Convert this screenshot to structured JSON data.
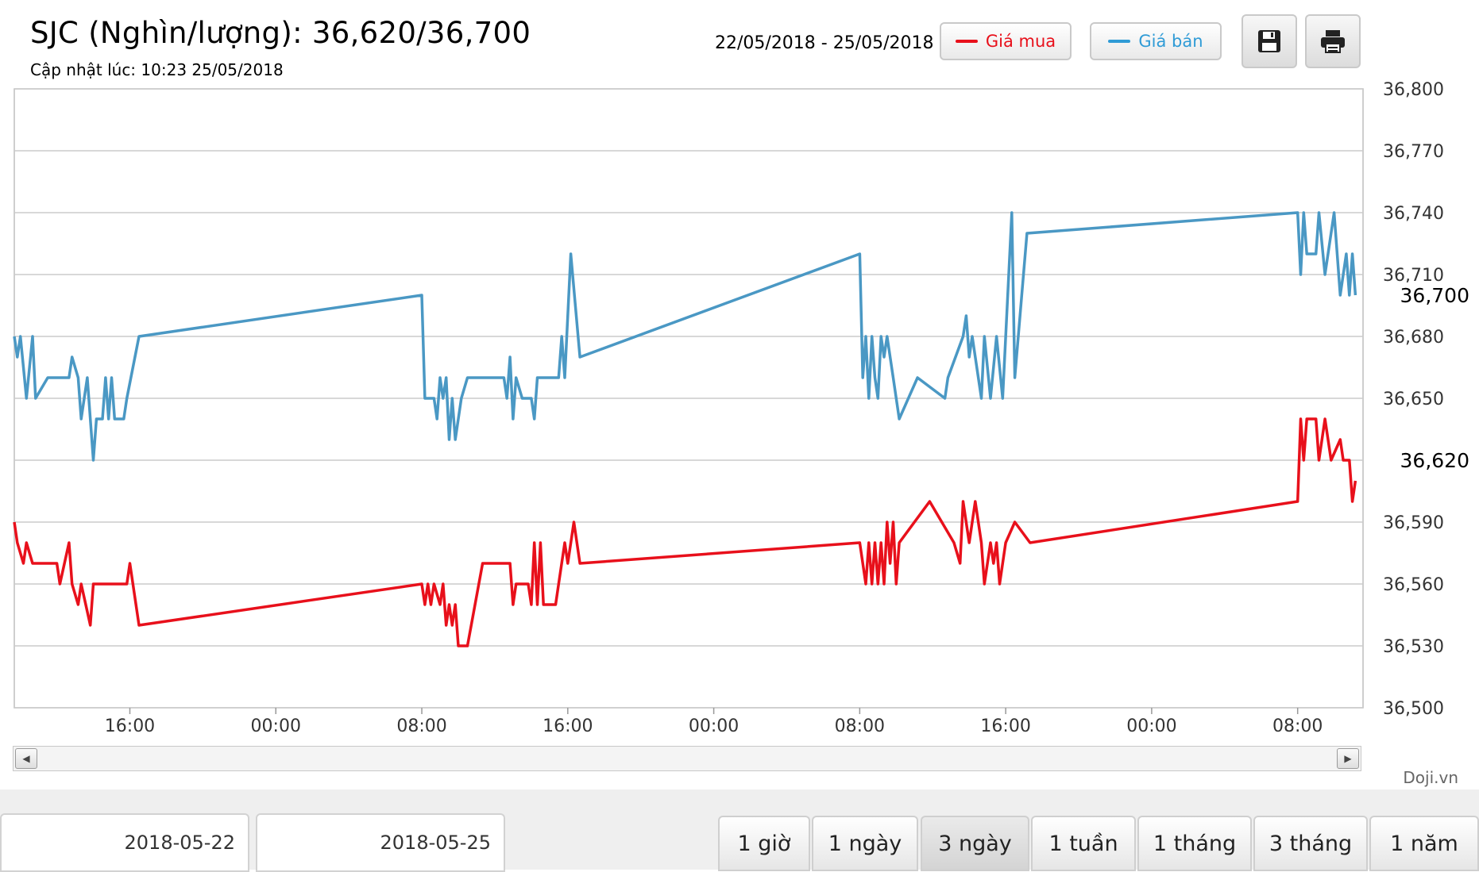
{
  "header": {
    "title": "SJC (Nghìn/lượng): 36,620/36,700",
    "updated": "Cập nhật lúc: 10:23 25/05/2018",
    "date_range": "22/05/2018 - 25/05/2018"
  },
  "legend": {
    "buy_label": "Giá mua",
    "sell_label": "Giá bán"
  },
  "toolbar": {
    "save_icon": "floppy-disk-icon",
    "print_icon": "printer-icon"
  },
  "credit": "Doji.vn",
  "date_inputs": {
    "from": "2018-05-22",
    "to": "2018-05-25"
  },
  "ranges": [
    {
      "label": "1 giờ",
      "active": false
    },
    {
      "label": "1 ngày",
      "active": false
    },
    {
      "label": "3 ngày",
      "active": true
    },
    {
      "label": "1 tuần",
      "active": false
    },
    {
      "label": "1 tháng",
      "active": false
    },
    {
      "label": "3 tháng",
      "active": false
    },
    {
      "label": "1 năm",
      "active": false
    }
  ],
  "colors": {
    "buy": "#e8101b",
    "sell": "#4a98c4",
    "grid": "#cccccc"
  },
  "chart_data": {
    "type": "line",
    "title": "",
    "ylim": [
      36500,
      36800
    ],
    "y_ticks": [
      36500,
      36530,
      36560,
      36590,
      36620,
      36650,
      36680,
      36710,
      36740,
      36770,
      36800
    ],
    "y_tick_labels": [
      "36,500",
      "36,530",
      "36,560",
      "36,590",
      "36,620",
      "36,650",
      "36,680",
      "36,710",
      "36,740",
      "36,770",
      "36,800"
    ],
    "xlim": [
      "2018-05-22 09:40",
      "2018-05-25 11:35"
    ],
    "x_ticks": [
      "2018-05-22 16:00",
      "2018-05-23 00:00",
      "2018-05-23 08:00",
      "2018-05-23 16:00",
      "2018-05-24 00:00",
      "2018-05-24 08:00",
      "2018-05-24 16:00",
      "2018-05-25 00:00",
      "2018-05-25 08:00"
    ],
    "x_tick_labels": [
      "16:00",
      "00:00",
      "08:00",
      "16:00",
      "00:00",
      "08:00",
      "16:00",
      "00:00",
      "08:00"
    ],
    "current_labels": [
      {
        "series": "Giá bán",
        "value": 36700,
        "text": "36,700"
      },
      {
        "series": "Giá mua",
        "value": 36620,
        "text": "36,620"
      }
    ],
    "series": [
      {
        "name": "Giá bán",
        "color": "#4a98c4",
        "points": [
          [
            "2018-05-22 09:40",
            36680
          ],
          [
            "2018-05-22 09:50",
            36670
          ],
          [
            "2018-05-22 10:00",
            36680
          ],
          [
            "2018-05-22 10:20",
            36650
          ],
          [
            "2018-05-22 10:40",
            36680
          ],
          [
            "2018-05-22 10:50",
            36650
          ],
          [
            "2018-05-22 11:30",
            36660
          ],
          [
            "2018-05-22 12:00",
            36660
          ],
          [
            "2018-05-22 12:20",
            36660
          ],
          [
            "2018-05-22 12:40",
            36660
          ],
          [
            "2018-05-22 12:50",
            36670
          ],
          [
            "2018-05-22 13:10",
            36660
          ],
          [
            "2018-05-22 13:20",
            36640
          ],
          [
            "2018-05-22 13:40",
            36660
          ],
          [
            "2018-05-22 13:50",
            36640
          ],
          [
            "2018-05-22 14:00",
            36620
          ],
          [
            "2018-05-22 14:10",
            36640
          ],
          [
            "2018-05-22 14:30",
            36640
          ],
          [
            "2018-05-22 14:40",
            36660
          ],
          [
            "2018-05-22 14:50",
            36640
          ],
          [
            "2018-05-22 15:00",
            36660
          ],
          [
            "2018-05-22 15:10",
            36640
          ],
          [
            "2018-05-22 15:40",
            36640
          ],
          [
            "2018-05-22 15:50",
            36650
          ],
          [
            "2018-05-22 16:30",
            36680
          ],
          [
            "2018-05-23 08:00",
            36700
          ],
          [
            "2018-05-23 08:10",
            36650
          ],
          [
            "2018-05-23 08:20",
            36650
          ],
          [
            "2018-05-23 08:40",
            36650
          ],
          [
            "2018-05-23 08:50",
            36640
          ],
          [
            "2018-05-23 09:00",
            36660
          ],
          [
            "2018-05-23 09:10",
            36650
          ],
          [
            "2018-05-23 09:20",
            36660
          ],
          [
            "2018-05-23 09:30",
            36630
          ],
          [
            "2018-05-23 09:40",
            36650
          ],
          [
            "2018-05-23 09:50",
            36630
          ],
          [
            "2018-05-23 10:10",
            36650
          ],
          [
            "2018-05-23 10:30",
            36660
          ],
          [
            "2018-05-23 12:30",
            36660
          ],
          [
            "2018-05-23 12:40",
            36650
          ],
          [
            "2018-05-23 12:50",
            36670
          ],
          [
            "2018-05-23 13:00",
            36640
          ],
          [
            "2018-05-23 13:10",
            36660
          ],
          [
            "2018-05-23 13:30",
            36650
          ],
          [
            "2018-05-23 14:00",
            36650
          ],
          [
            "2018-05-23 14:10",
            36640
          ],
          [
            "2018-05-23 14:20",
            36660
          ],
          [
            "2018-05-23 15:30",
            36660
          ],
          [
            "2018-05-23 15:40",
            36680
          ],
          [
            "2018-05-23 15:50",
            36660
          ],
          [
            "2018-05-23 16:10",
            36720
          ],
          [
            "2018-05-23 16:40",
            36670
          ],
          [
            "2018-05-24 08:00",
            36720
          ],
          [
            "2018-05-24 08:10",
            36660
          ],
          [
            "2018-05-24 08:20",
            36680
          ],
          [
            "2018-05-24 08:30",
            36650
          ],
          [
            "2018-05-24 08:40",
            36680
          ],
          [
            "2018-05-24 08:50",
            36660
          ],
          [
            "2018-05-24 09:00",
            36650
          ],
          [
            "2018-05-24 09:10",
            36680
          ],
          [
            "2018-05-24 09:20",
            36670
          ],
          [
            "2018-05-24 09:30",
            36680
          ],
          [
            "2018-05-24 09:50",
            36660
          ],
          [
            "2018-05-24 10:10",
            36640
          ],
          [
            "2018-05-24 11:10",
            36660
          ],
          [
            "2018-05-24 12:40",
            36650
          ],
          [
            "2018-05-24 12:50",
            36660
          ],
          [
            "2018-05-24 13:40",
            36680
          ],
          [
            "2018-05-24 13:50",
            36690
          ],
          [
            "2018-05-24 14:00",
            36670
          ],
          [
            "2018-05-24 14:10",
            36680
          ],
          [
            "2018-05-24 14:40",
            36650
          ],
          [
            "2018-05-24 14:50",
            36680
          ],
          [
            "2018-05-24 15:10",
            36650
          ],
          [
            "2018-05-24 15:30",
            36680
          ],
          [
            "2018-05-24 15:50",
            36650
          ],
          [
            "2018-05-24 16:20",
            36740
          ],
          [
            "2018-05-24 16:30",
            36660
          ],
          [
            "2018-05-24 17:10",
            36730
          ],
          [
            "2018-05-25 08:00",
            36740
          ],
          [
            "2018-05-25 08:10",
            36710
          ],
          [
            "2018-05-25 08:20",
            36740
          ],
          [
            "2018-05-25 08:30",
            36720
          ],
          [
            "2018-05-25 09:00",
            36720
          ],
          [
            "2018-05-25 09:10",
            36740
          ],
          [
            "2018-05-25 09:30",
            36710
          ],
          [
            "2018-05-25 10:00",
            36740
          ],
          [
            "2018-05-25 10:20",
            36700
          ],
          [
            "2018-05-25 10:40",
            36720
          ],
          [
            "2018-05-25 10:50",
            36700
          ],
          [
            "2018-05-25 11:00",
            36720
          ],
          [
            "2018-05-25 11:10",
            36700
          ]
        ]
      },
      {
        "name": "Giá mua",
        "color": "#e8101b",
        "points": [
          [
            "2018-05-22 09:40",
            36590
          ],
          [
            "2018-05-22 09:50",
            36580
          ],
          [
            "2018-05-22 10:10",
            36570
          ],
          [
            "2018-05-22 10:20",
            36580
          ],
          [
            "2018-05-22 10:40",
            36570
          ],
          [
            "2018-05-22 12:00",
            36570
          ],
          [
            "2018-05-22 12:10",
            36560
          ],
          [
            "2018-05-22 12:40",
            36580
          ],
          [
            "2018-05-22 12:50",
            36560
          ],
          [
            "2018-05-22 13:10",
            36550
          ],
          [
            "2018-05-22 13:20",
            36560
          ],
          [
            "2018-05-22 13:50",
            36540
          ],
          [
            "2018-05-22 14:00",
            36560
          ],
          [
            "2018-05-22 15:50",
            36560
          ],
          [
            "2018-05-22 16:00",
            36570
          ],
          [
            "2018-05-22 16:30",
            36540
          ],
          [
            "2018-05-23 08:00",
            36560
          ],
          [
            "2018-05-23 08:10",
            36550
          ],
          [
            "2018-05-23 08:20",
            36560
          ],
          [
            "2018-05-23 08:30",
            36550
          ],
          [
            "2018-05-23 08:40",
            36560
          ],
          [
            "2018-05-23 09:00",
            36550
          ],
          [
            "2018-05-23 09:10",
            36560
          ],
          [
            "2018-05-23 09:20",
            36540
          ],
          [
            "2018-05-23 09:30",
            36550
          ],
          [
            "2018-05-23 09:40",
            36540
          ],
          [
            "2018-05-23 09:50",
            36550
          ],
          [
            "2018-05-23 10:00",
            36530
          ],
          [
            "2018-05-23 10:30",
            36530
          ],
          [
            "2018-05-23 11:20",
            36570
          ],
          [
            "2018-05-23 12:50",
            36570
          ],
          [
            "2018-05-23 13:00",
            36550
          ],
          [
            "2018-05-23 13:10",
            36560
          ],
          [
            "2018-05-23 13:50",
            36560
          ],
          [
            "2018-05-23 14:00",
            36550
          ],
          [
            "2018-05-23 14:10",
            36580
          ],
          [
            "2018-05-23 14:20",
            36550
          ],
          [
            "2018-05-23 14:30",
            36580
          ],
          [
            "2018-05-23 14:40",
            36550
          ],
          [
            "2018-05-23 15:20",
            36550
          ],
          [
            "2018-05-23 15:30",
            36560
          ],
          [
            "2018-05-23 15:50",
            36580
          ],
          [
            "2018-05-23 16:00",
            36570
          ],
          [
            "2018-05-23 16:20",
            36590
          ],
          [
            "2018-05-23 16:40",
            36570
          ],
          [
            "2018-05-24 08:00",
            36580
          ],
          [
            "2018-05-24 08:10",
            36570
          ],
          [
            "2018-05-24 08:20",
            36560
          ],
          [
            "2018-05-24 08:30",
            36580
          ],
          [
            "2018-05-24 08:40",
            36560
          ],
          [
            "2018-05-24 08:50",
            36580
          ],
          [
            "2018-05-24 09:00",
            36560
          ],
          [
            "2018-05-24 09:10",
            36580
          ],
          [
            "2018-05-24 09:20",
            36560
          ],
          [
            "2018-05-24 09:30",
            36590
          ],
          [
            "2018-05-24 09:40",
            36570
          ],
          [
            "2018-05-24 09:50",
            36590
          ],
          [
            "2018-05-24 10:00",
            36560
          ],
          [
            "2018-05-24 10:10",
            36580
          ],
          [
            "2018-05-24 11:50",
            36600
          ],
          [
            "2018-05-24 13:10",
            36580
          ],
          [
            "2018-05-24 13:30",
            36570
          ],
          [
            "2018-05-24 13:40",
            36600
          ],
          [
            "2018-05-24 14:00",
            36580
          ],
          [
            "2018-05-24 14:20",
            36600
          ],
          [
            "2018-05-24 14:40",
            36580
          ],
          [
            "2018-05-24 14:50",
            36560
          ],
          [
            "2018-05-24 15:10",
            36580
          ],
          [
            "2018-05-24 15:20",
            36570
          ],
          [
            "2018-05-24 15:30",
            36580
          ],
          [
            "2018-05-24 15:40",
            36560
          ],
          [
            "2018-05-24 16:00",
            36580
          ],
          [
            "2018-05-24 16:30",
            36590
          ],
          [
            "2018-05-24 17:20",
            36580
          ],
          [
            "2018-05-25 08:00",
            36600
          ],
          [
            "2018-05-25 08:10",
            36640
          ],
          [
            "2018-05-25 08:20",
            36620
          ],
          [
            "2018-05-25 08:30",
            36640
          ],
          [
            "2018-05-25 09:00",
            36640
          ],
          [
            "2018-05-25 09:10",
            36620
          ],
          [
            "2018-05-25 09:30",
            36640
          ],
          [
            "2018-05-25 09:50",
            36620
          ],
          [
            "2018-05-25 10:20",
            36630
          ],
          [
            "2018-05-25 10:30",
            36620
          ],
          [
            "2018-05-25 10:50",
            36620
          ],
          [
            "2018-05-25 11:00",
            36600
          ],
          [
            "2018-05-25 11:10",
            36610
          ]
        ]
      }
    ]
  }
}
